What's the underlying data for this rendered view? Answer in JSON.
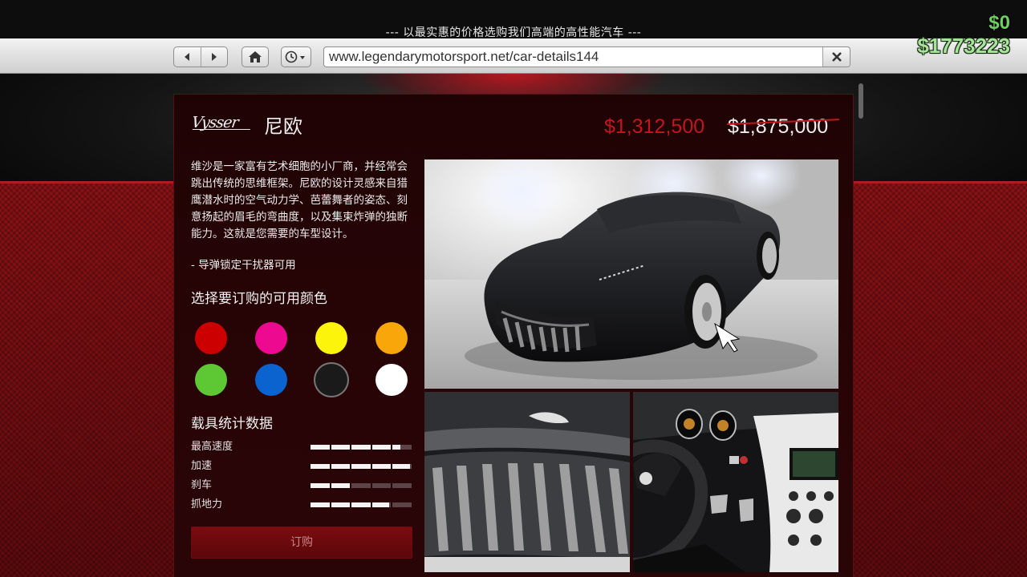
{
  "browser": {
    "window_title": "--- 以最实惠的价格选购我们高端的高性能汽车 ---",
    "url": "www.legendarymotorsport.net/car-details144",
    "back_icon": "back-arrow-icon",
    "forward_icon": "forward-arrow-icon",
    "home_icon": "home-icon",
    "history_icon": "history-clock-icon",
    "clear_icon": "close-icon"
  },
  "hud": {
    "change": "$0",
    "balance": "$1773223"
  },
  "product": {
    "brand_logo": "Vysser",
    "name": "尼欧",
    "sale_price": "$1,312,500",
    "original_price": "$1,875,000",
    "description": "维沙是一家富有艺术细胞的小厂商，并经常会跳出传统的思维框架。尼欧的设计灵感来自猎鹰潜水时的空气动力学、芭蕾舞者的姿态、刻意扬起的眉毛的弯曲度，以及集束炸弹的独断能力。这就是您需要的车型设计。",
    "features": [
      "- 导弹锁定干扰器可用"
    ],
    "colors_heading": "选择要订购的可用颜色",
    "colors": [
      {
        "name": "red",
        "hex": "#cc0000"
      },
      {
        "name": "pink",
        "hex": "#ee0a90"
      },
      {
        "name": "yellow",
        "hex": "#fcf50b"
      },
      {
        "name": "orange",
        "hex": "#f9a60b"
      },
      {
        "name": "green",
        "hex": "#5ec834"
      },
      {
        "name": "blue",
        "hex": "#0a63cf"
      },
      {
        "name": "black",
        "hex": "#1a1a1a",
        "selected": true
      },
      {
        "name": "white",
        "hex": "#ffffff"
      }
    ],
    "stats_heading": "载具统计数据",
    "stats": [
      {
        "label": "最高速度",
        "value": 0.88
      },
      {
        "label": "加速",
        "value": 0.98
      },
      {
        "label": "刹车",
        "value": 0.4
      },
      {
        "label": "抓地力",
        "value": 0.78
      }
    ],
    "buy_label": "订购"
  },
  "accent_colors": {
    "price_red": "#c4161c",
    "panel_bg": "#260406",
    "money_green": "#a7e39a"
  }
}
